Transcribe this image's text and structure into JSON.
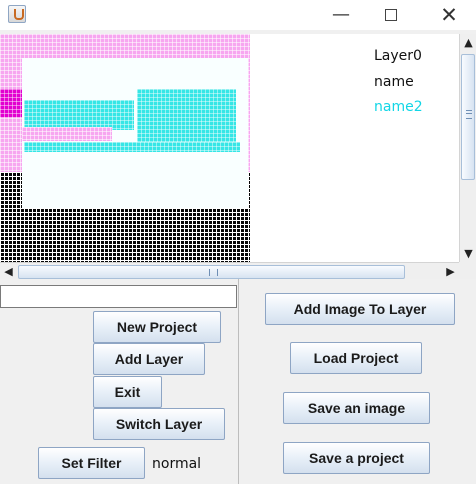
{
  "window": {
    "icon": "java-cup-icon",
    "minimize_glyph": "—",
    "close_glyph": "✕"
  },
  "canvas": {
    "layers": [
      "Layer0",
      "name",
      "name2"
    ],
    "active_layer": "name2",
    "colors": {
      "pink": "#f7a6f0",
      "cyan": "#36e6e6",
      "magenta": "#e200cf",
      "black": "#050505",
      "active_text": "#12d6e6"
    }
  },
  "left_panel": {
    "text_field_value": "",
    "buttons": {
      "new_project": "New Project",
      "add_layer": "Add Layer",
      "exit": "Exit",
      "switch_layer": "Switch Layer",
      "set_filter": "Set Filter"
    },
    "filter_status": "normal"
  },
  "right_panel": {
    "buttons": {
      "add_image_to_layer": "Add Image To Layer",
      "load_project": "Load Project",
      "save_image": "Save an image",
      "save_project": "Save a project"
    }
  },
  "scrollbars": {
    "up_arrow": "▲",
    "down_arrow": "▼",
    "left_arrow": "◀",
    "right_arrow": "▶"
  }
}
